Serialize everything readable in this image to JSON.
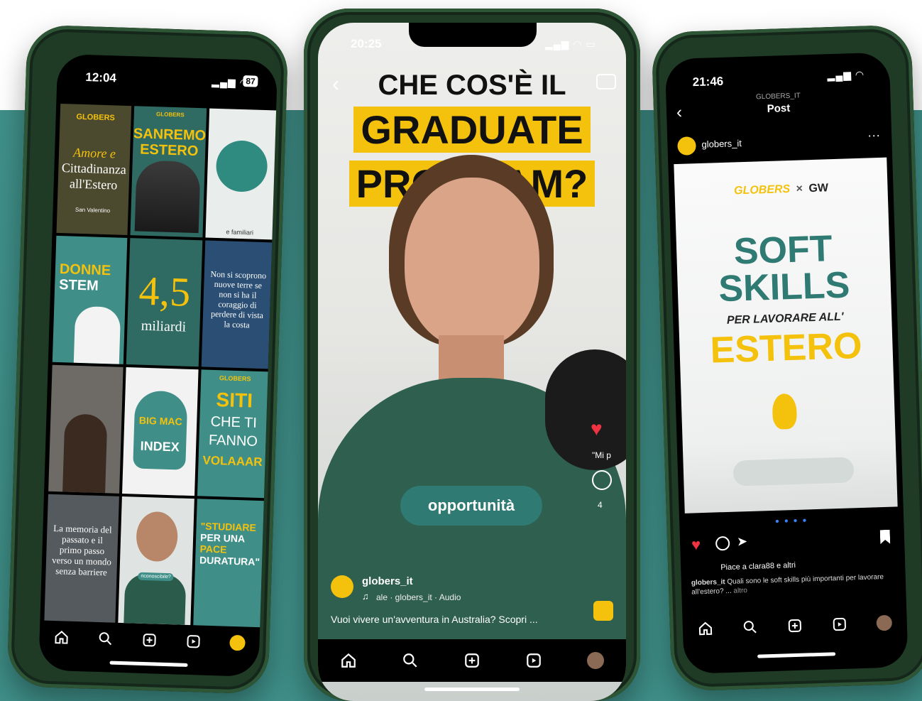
{
  "left_phone": {
    "time": "12:04",
    "battery": "87",
    "tiles": {
      "t1": {
        "logo": "GLOBERS",
        "line1": "Amore e",
        "line2": "Cittadinanza",
        "line3": "all'Estero",
        "tag": "San Valentino"
      },
      "t2": {
        "small": "GLOBERS",
        "title1": "SANREMO",
        "title2": "ESTERO"
      },
      "t3": {
        "label": "e familiari"
      },
      "t4": {
        "title1": "DONNE",
        "title2": "STEM"
      },
      "t5": {
        "num": "4,5",
        "word": "miliardi"
      },
      "t6": {
        "text": "Non si scoprono nuove terre se non si ha il coraggio di perdere di vista la costa"
      },
      "t8": {
        "title1": "BIG MAC",
        "title2": "INDEX"
      },
      "t9": {
        "logo": "GLOBERS",
        "line1": "SITI",
        "line2": "CHE TI",
        "line3": "FANNO",
        "line4": "VOLAAAR"
      },
      "t10": {
        "text": "La memoria del passato e il primo passo verso un mondo senza barriere"
      },
      "t11": {
        "caption": "riconoscibile?"
      },
      "t12": {
        "line1": "\"STUDIARE",
        "line2": "PER UNA",
        "line3": "PACE",
        "line4": "DURATURA\""
      }
    }
  },
  "center_phone": {
    "time": "20:25",
    "headline1": "CHE COS'È IL",
    "headline2": "GRADUATE",
    "headline3": "PROGRAM?",
    "caption_pill": "opportunità",
    "username": "globers_it",
    "audio": "ale · globers_it · Audio",
    "description": "Vuoi vivere un'avventura in Australia? Scopri ...",
    "comment_preview": "\"Mi p",
    "comment_count": "4"
  },
  "right_phone": {
    "time": "21:46",
    "header_small": "GLOBERS_IT",
    "header_title": "Post",
    "username": "globers_it",
    "brand_left": "GLOBERS",
    "brand_x": "×",
    "brand_right": "GW",
    "title1": "SOFT",
    "title2": "SKILLS",
    "subtitle": "PER LAVORARE ALL'",
    "title3": "ESTERO",
    "likes": "Piace a clara88 e altri",
    "caption_user": "globers_it",
    "caption_text": "Quali sono le soft skills più importanti per lavorare all'estero? ...",
    "caption_more": "altro"
  },
  "colors": {
    "teal": "#3f8f88",
    "yellow": "#f4c20d",
    "dark_green": "#1f3b25"
  },
  "icons": [
    "home-icon",
    "search-icon",
    "add-icon",
    "reels-icon",
    "profile-icon",
    "heart-icon",
    "comment-icon",
    "share-icon",
    "bookmark-icon",
    "camera-icon",
    "back-icon",
    "more-icon",
    "music-icon"
  ]
}
